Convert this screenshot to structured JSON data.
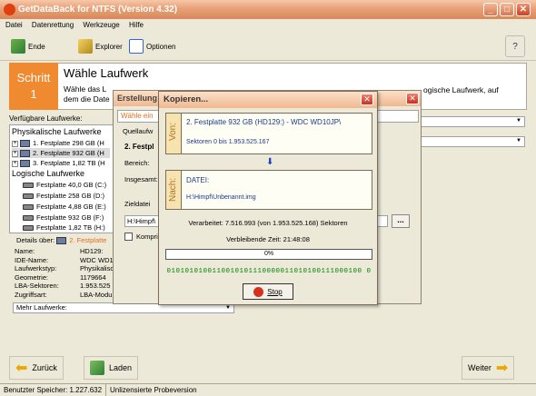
{
  "window": {
    "title": "GetDataBack for NTFS (Version 4.32)"
  },
  "menu": [
    "Datei",
    "Datenrettung",
    "Werkzeuge",
    "Hilfe"
  ],
  "toolbar": {
    "ende": "Ende",
    "explorer": "Explorer",
    "optionen": "Optionen"
  },
  "step": {
    "label": "Schritt",
    "number": "1",
    "title": "Wähle Laufwerk",
    "desc_line1": "Wähle das L",
    "desc_line2": "dem die Date",
    "desc_right1": "ogische Laufwerk, auf"
  },
  "left": {
    "header": "Verfügbare Laufwerke:",
    "physical_title": "Physikalische Laufwerke",
    "physical": [
      "1. Festplatte 298 GB (H",
      "2. Festplatte 932 GB (H",
      "3. Festplatte 1,82 TB (H"
    ],
    "logical_title": "Logische Laufwerke",
    "logical": [
      "Festplatte 40,0 GB (C:)",
      "Festplatte 258 GB (D:)",
      "Festplatte 4,88 GB (E:)",
      "Festplatte 932 GB (F:)",
      "Festplatte 1,82 TB (H:)"
    ],
    "details_label": "Details über:",
    "details_value": "2. Festplatte",
    "details": [
      {
        "k": "Name:",
        "v": "HD129:"
      },
      {
        "k": "IDE-Name:",
        "v": "WDC WD1"
      },
      {
        "k": "Laufwerkstyp:",
        "v": "Physikalisc"
      },
      {
        "k": "Geometrie:",
        "v": "1179664"
      },
      {
        "k": "LBA-Sektoren:",
        "v": "1.953.525"
      },
      {
        "k": "Zugriffsart:",
        "v": "LBA-Modu"
      }
    ],
    "more_label": "Mehr Laufwerke:"
  },
  "erstellung": {
    "title": "Erstellung",
    "wahle": "Wähle ein",
    "quell": "Quellaufw",
    "festpl": "2. Festpl",
    "bereich": "Bereich:",
    "insgesamt": "Insgesamt:",
    "zieldatei": "Zieldatei",
    "path": "H:\\Himpf\\",
    "kompri": "Kompri",
    "browse": "..."
  },
  "copy": {
    "title": "Kopieren...",
    "von_label": "Von:",
    "von_drive": "2. Festplatte 932 GB (HD129:) - WDC WD10JP\\",
    "von_sectors": "Sektoren 0 bis 1.953.525.167",
    "nach_label": "Nach:",
    "nach_type": "DATEI:",
    "nach_path": "H:\\Himpf\\Unbenannt.img",
    "processed": "Verarbeitet: 7.516.993 (von 1.953.525.168) Sektoren",
    "remaining": "Verbleibende Zeit: 21:48:08",
    "progress_text": "0%",
    "progress": 0,
    "bits": "0101010100110010101110000011010100111000100 0",
    "stop": "Stop"
  },
  "nav": {
    "back": "Zurück",
    "load": "Laden",
    "next": "Weiter"
  },
  "status": {
    "memory": "Benutzter Speicher: 1.227.632",
    "version": "Unlizensierte Probeversion"
  }
}
